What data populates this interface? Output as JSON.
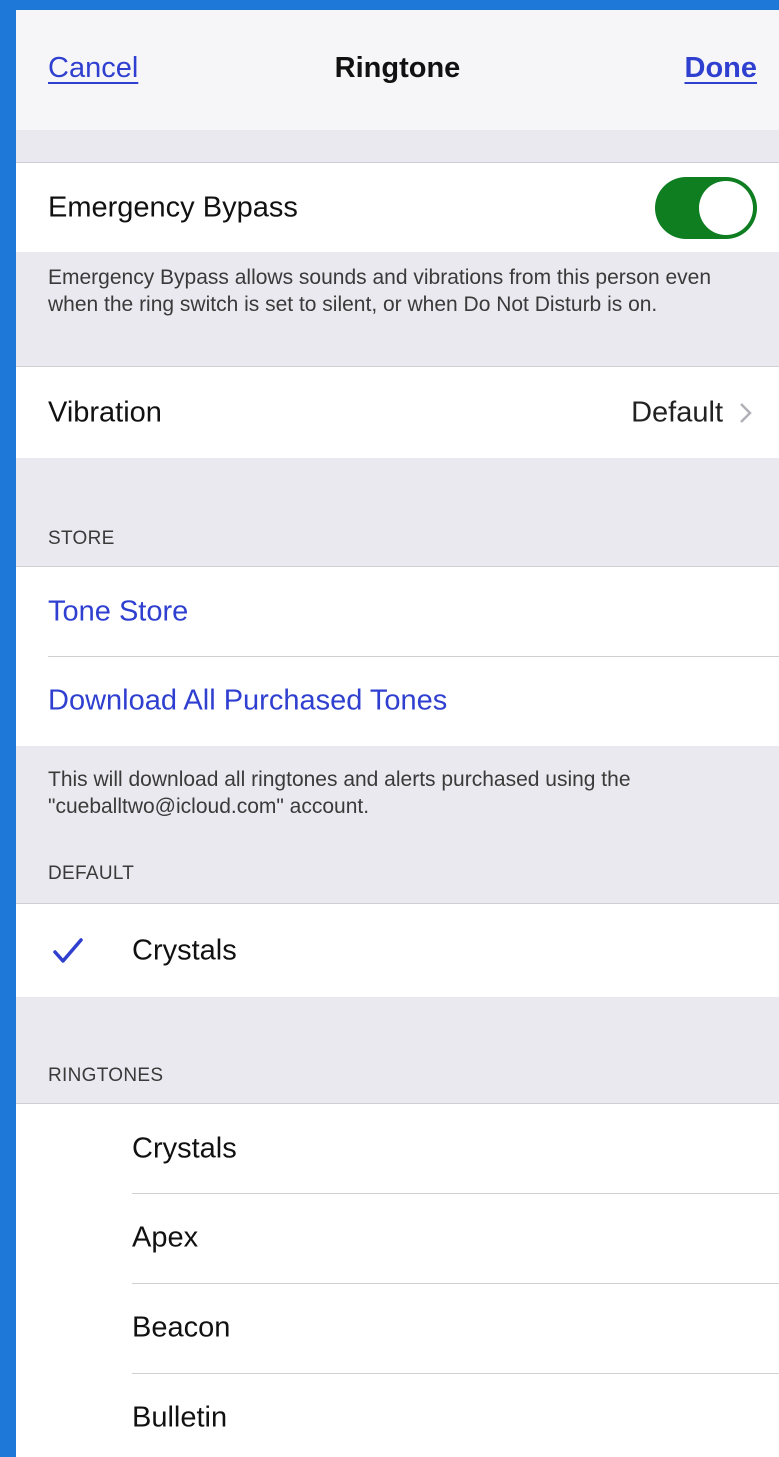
{
  "nav": {
    "cancel_label": "Cancel",
    "title": "Ringtone",
    "done_label": "Done"
  },
  "emergency_bypass": {
    "label": "Emergency Bypass",
    "enabled": true,
    "footer": "Emergency Bypass allows sounds and vibrations from this person even when the ring switch is set to silent, or when Do Not Disturb is on."
  },
  "vibration": {
    "label": "Vibration",
    "value": "Default"
  },
  "store": {
    "header": "STORE",
    "items": [
      {
        "label": "Tone Store"
      },
      {
        "label": "Download All Purchased Tones"
      }
    ],
    "footer": "This will download all ringtones and alerts purchased using the \"cueballtwo@icloud.com\" account."
  },
  "default_section": {
    "header": "DEFAULT",
    "items": [
      {
        "label": "Crystals",
        "selected": true
      }
    ]
  },
  "ringtones": {
    "header": "RINGTONES",
    "items": [
      {
        "label": "Crystals"
      },
      {
        "label": "Apex"
      },
      {
        "label": "Beacon"
      },
      {
        "label": "Bulletin"
      }
    ]
  },
  "colors": {
    "accent": "#2f3fd0",
    "toggle_on": "#0f7e21",
    "frame": "#1e78d8",
    "grouped_background": "#e9e9ef"
  },
  "icons": [
    "chevron-right-icon",
    "checkmark-icon"
  ]
}
